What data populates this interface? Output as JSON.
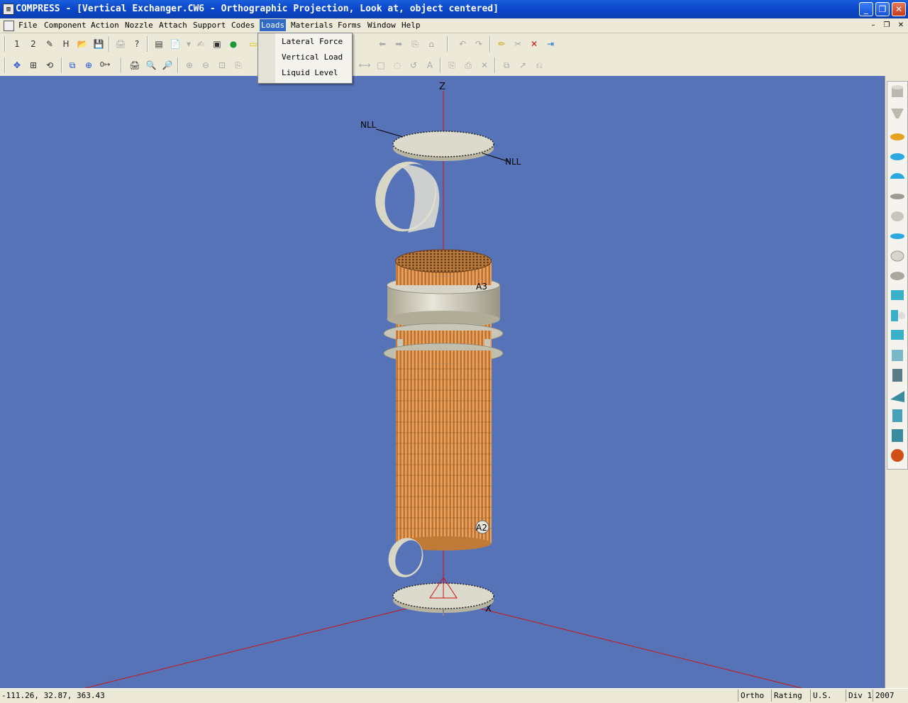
{
  "window": {
    "title": "COMPRESS - [Vertical Exchanger.CW6 - Orthographic Projection, Look at, object centered]",
    "minimize": "_",
    "maximize": "❐",
    "close": "✕"
  },
  "menu": {
    "items": [
      "File",
      "Component",
      "Action",
      "Nozzle",
      "Attach",
      "Support",
      "Codes",
      "Loads",
      "Materials",
      "Forms",
      "Window",
      "Help"
    ],
    "active": "Loads",
    "mdi_min": "–",
    "mdi_restore": "❐",
    "mdi_close": "✕"
  },
  "loads_menu": {
    "items": [
      "Lateral Force",
      "Vertical Load",
      "Liquid Level"
    ]
  },
  "toolbar1": {
    "buttons": [
      "1",
      "2",
      "✎",
      "H",
      "📂",
      "💾",
      "🖨",
      "?",
      "▤",
      "📄",
      "▾",
      "✍",
      "▣",
      "●",
      "▭"
    ],
    "right_buttons": [
      "⬅",
      "➡",
      "⎘",
      "⌂",
      "↶",
      "↷",
      "✏",
      "✂",
      "✕",
      "⇥"
    ]
  },
  "toolbar2": {
    "buttons": [
      "✥",
      "⊞",
      "⟲",
      "⧉",
      "⊕",
      "0↦",
      "🖨",
      "🔍",
      "🔎",
      "⊕",
      "⊖",
      "⊡",
      "⎘"
    ],
    "right_buttons": [
      "⟷",
      "□",
      "◌",
      "↺",
      "A",
      "⎘",
      "⎙",
      "✕",
      "⧉",
      "↗",
      "⎌"
    ]
  },
  "viewport": {
    "axis_z": "Z",
    "axis_x": "X",
    "labels": {
      "nll_left": "NLL",
      "nll_right": "NLL",
      "a3": "A3",
      "a2": "A2"
    }
  },
  "status": {
    "coords": "-111.26, 32.87, 363.43",
    "projection": "Ortho",
    "mode": "Rating",
    "units": "U.S.",
    "division": "Div 1",
    "year": "2007"
  },
  "colors": {
    "viewport_bg": "#5673b8",
    "tube_orange": "#d9904a",
    "shell_gray": "#c8c4b0",
    "axis_red": "#cc1111",
    "title_blue": "#0a46c8"
  }
}
